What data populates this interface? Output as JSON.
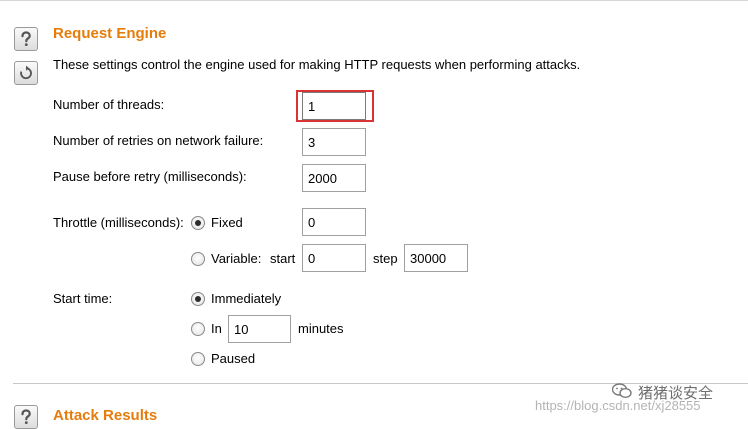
{
  "section1": {
    "title": "Request Engine",
    "description": "These settings control the engine used for making HTTP requests when performing attacks.",
    "help_icon": "question-mark-icon",
    "reset_icon": "refresh-icon"
  },
  "fields": {
    "threads": {
      "label": "Number of threads:",
      "value": "1"
    },
    "retries": {
      "label": "Number of retries on network failure:",
      "value": "3"
    },
    "pause": {
      "label": "Pause before retry (milliseconds):",
      "value": "2000"
    }
  },
  "throttle": {
    "label": "Throttle (milliseconds):",
    "fixed_label": "Fixed",
    "fixed_value": "0",
    "variable_label": "Variable:",
    "start_label": "start",
    "start_value": "0",
    "step_label": "step",
    "step_value": "30000",
    "selected": "fixed"
  },
  "start_time": {
    "label": "Start time:",
    "immediately_label": "Immediately",
    "in_label": "In",
    "in_value": "10",
    "minutes_label": "minutes",
    "paused_label": "Paused",
    "selected": "immediately"
  },
  "section2": {
    "title": "Attack Results",
    "help_icon": "question-mark-icon"
  },
  "watermark": {
    "wechat_text": "猪猪谈安全",
    "wechat_icon": "wechat-icon",
    "url_text": "https://blog.csdn.net/xj28555"
  },
  "colors": {
    "accent": "#e57d0d",
    "highlight": "#d93434"
  }
}
